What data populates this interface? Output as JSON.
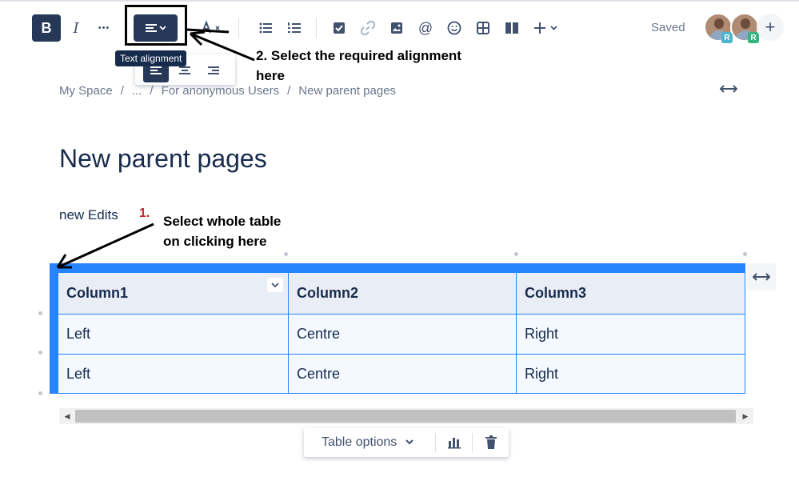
{
  "toolbar": {
    "bold": "B",
    "italic": "I",
    "more": "•••",
    "tooltip": "Text alignment",
    "saved": "Saved",
    "collaborators": [
      {
        "initial": "R",
        "badge_color": "#4bb4ce"
      },
      {
        "initial": "R",
        "badge_color": "#36b37e"
      }
    ],
    "add": "+"
  },
  "breadcrumb": [
    "My Space",
    "...",
    "For anonymous Users",
    "New parent pages"
  ],
  "page": {
    "title": "New parent pages",
    "text": "new Edits"
  },
  "annotations": {
    "step2_line1": "2. Select the required alignment",
    "step2_line2": "here",
    "step1_number": "1.",
    "step1_line1": "Select whole table",
    "step1_line2": "on clicking here"
  },
  "table": {
    "headers": [
      "Column1",
      "Column2",
      "Column3"
    ],
    "rows": [
      [
        "Left",
        "Centre",
        "Right"
      ],
      [
        "Left",
        "Centre",
        "Right"
      ]
    ]
  },
  "table_options": {
    "label": "Table options"
  },
  "colors": {
    "accent": "#2684ff",
    "dark_button": "#253858"
  }
}
